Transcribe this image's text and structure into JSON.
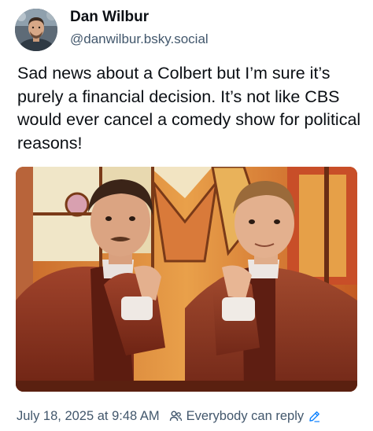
{
  "author": {
    "name": "Dan Wilbur",
    "handle": "@danwilbur.bsky.social"
  },
  "post": {
    "text": "Sad news about a Colbert but I’m sure it’s purely a financial decision. It’s not like CBS would ever cancel a comedy show for political reasons!"
  },
  "footer": {
    "timestamp": "July 18, 2025 at 9:48 AM",
    "reply_setting": "Everybody can reply",
    "people_icon": "people-icon",
    "edit_icon": "pencil-icon"
  },
  "colors": {
    "text": "#0b0f14",
    "muted": "#42576c",
    "link_blue": "#1083fe"
  }
}
